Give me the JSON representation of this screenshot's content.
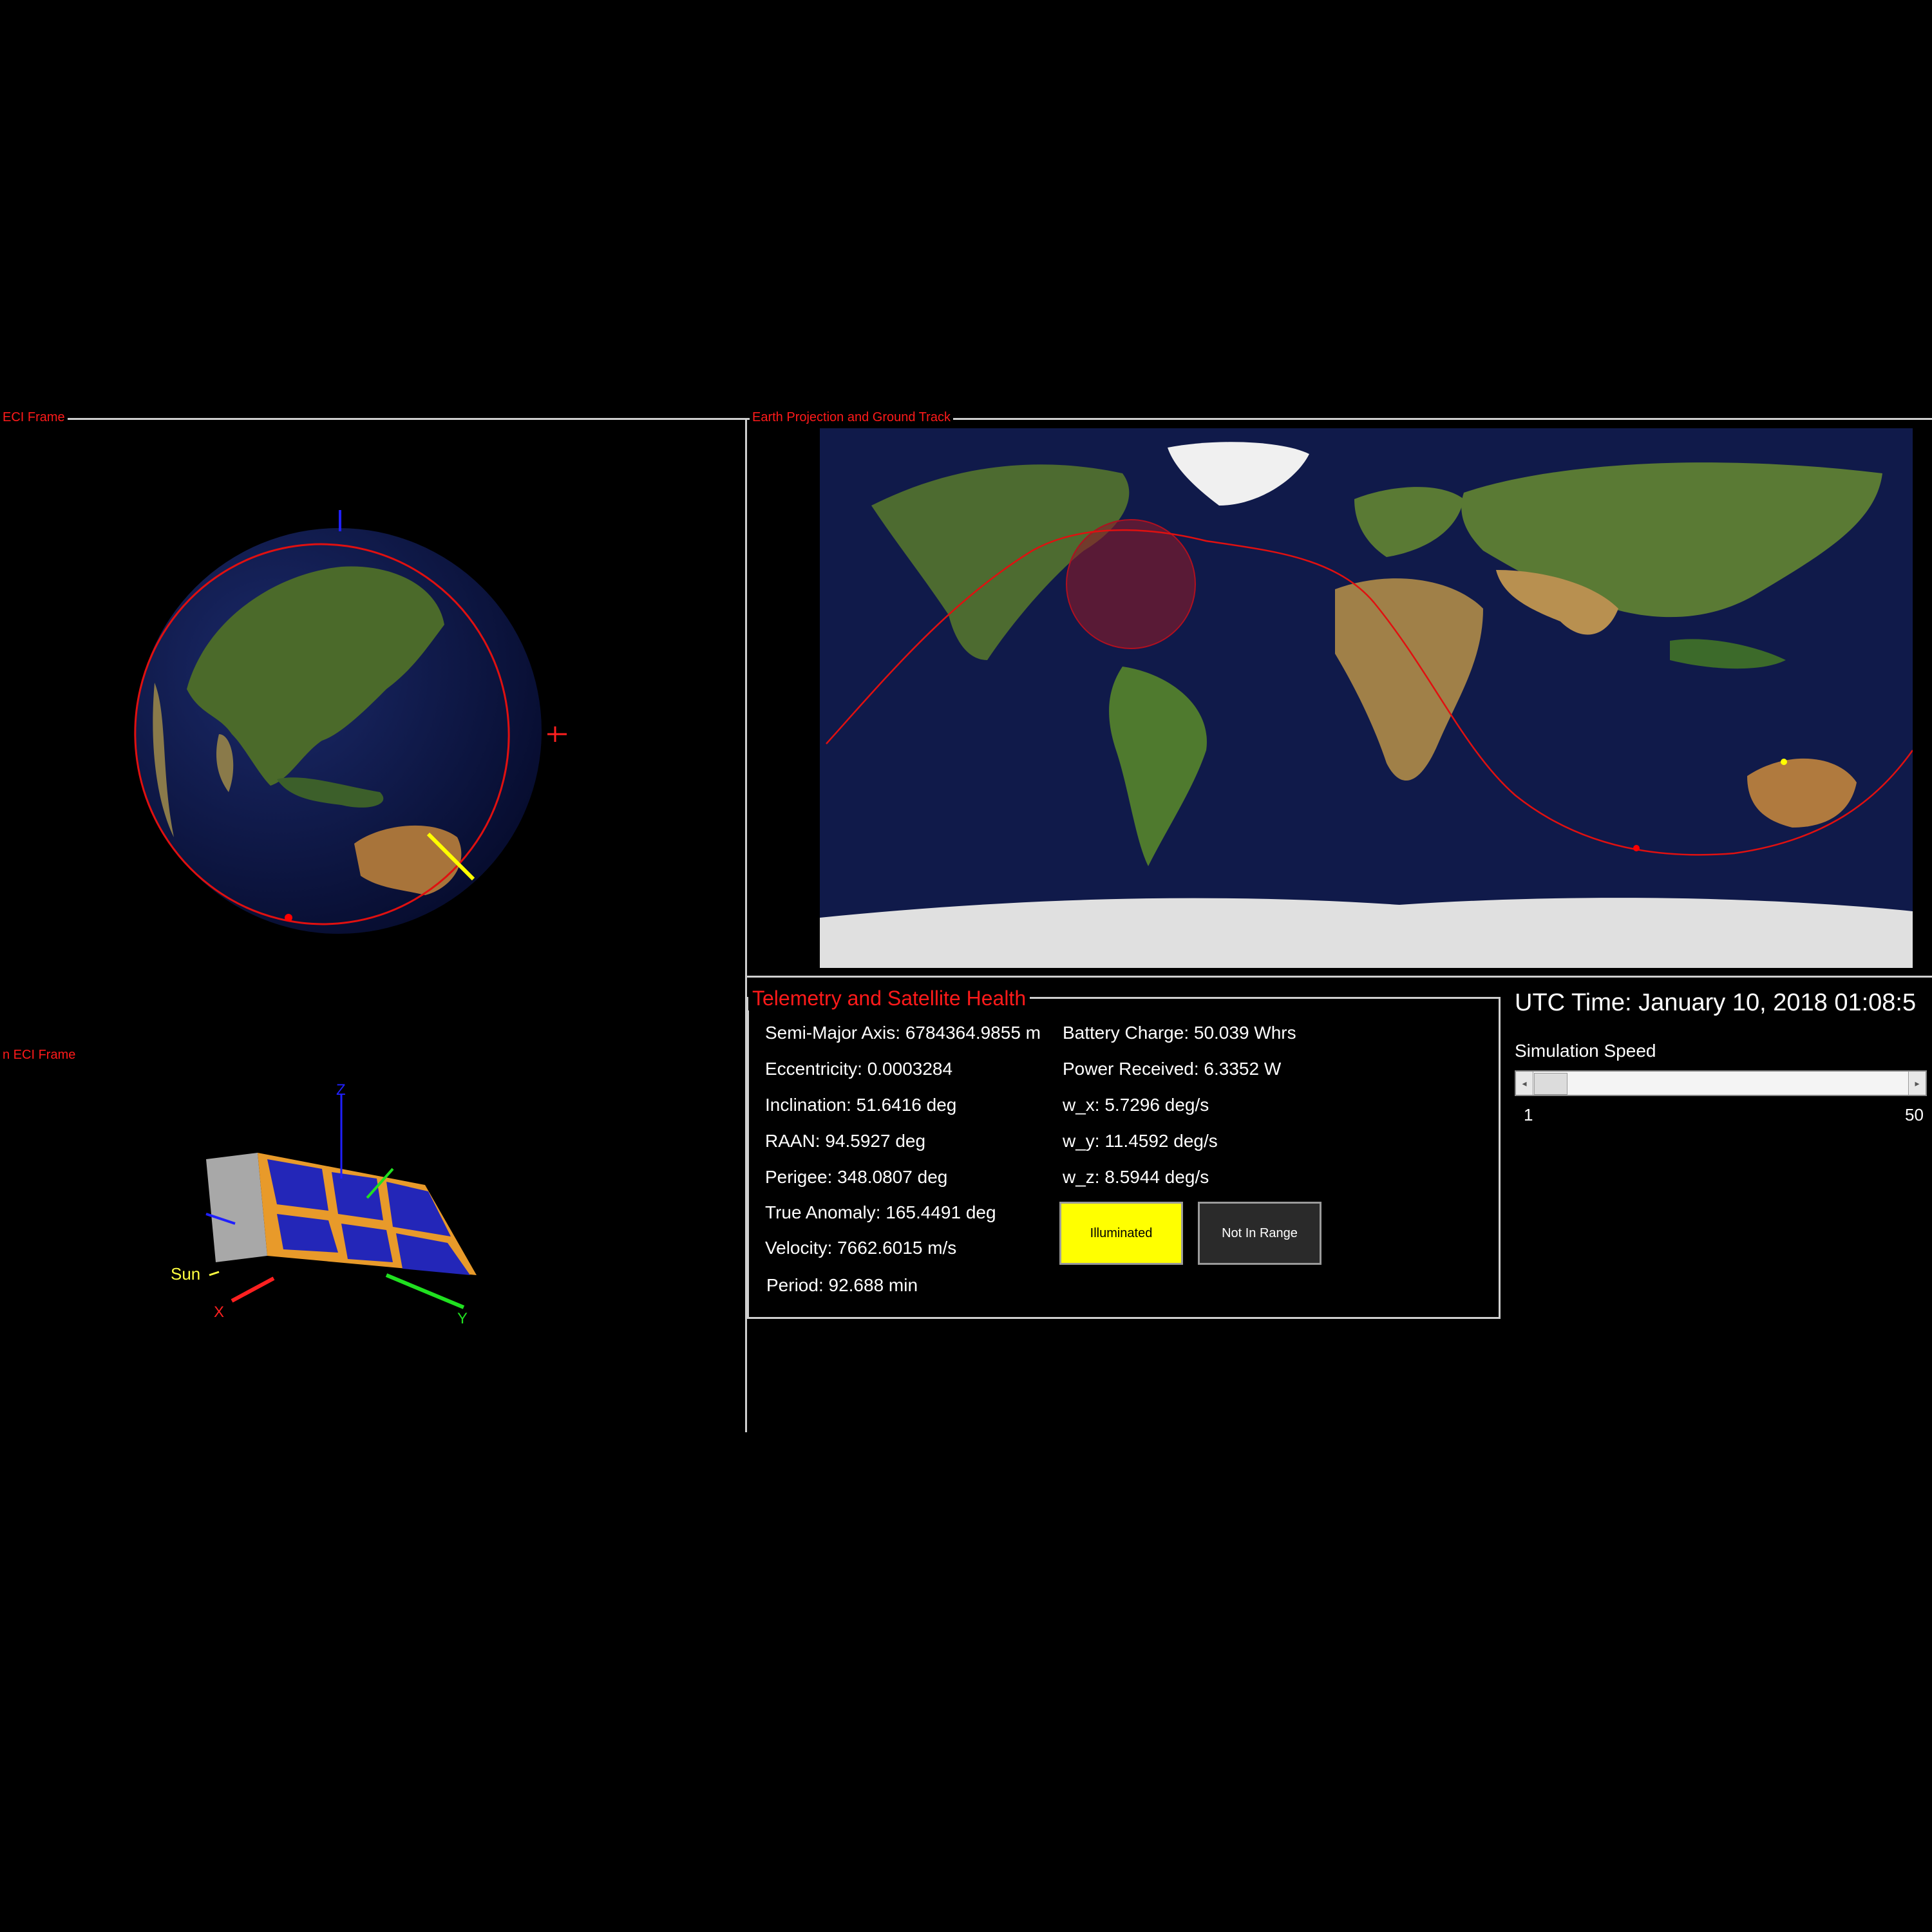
{
  "panels": {
    "eci_label": "ECI Frame",
    "attitude_label": "n ECI Frame",
    "map_label": "Earth Projection and Ground Track",
    "telemetry_label": "Telemetry and Satellite Health"
  },
  "telemetry": {
    "left": [
      "Semi-Major Axis: 6784364.9855 m",
      "Eccentricity: 0.0003284",
      "Inclination: 51.6416 deg",
      "RAAN: 94.5927 deg",
      "Perigee: 348.0807 deg",
      "True Anomaly: 165.4491 deg",
      "Velocity: 7662.6015 m/s",
      "Period: 92.688 min"
    ],
    "right": [
      "Battery Charge: 50.039 Whrs",
      "Power Received: 6.3352 W",
      "w_x: 5.7296 deg/s",
      "w_y: 11.4592 deg/s",
      "w_z: 8.5944 deg/s"
    ]
  },
  "status": {
    "illuminated_label": "Illuminated",
    "range_label": "Not In Range",
    "illuminated_color": "#ffff00",
    "range_color": "#2a2a2a"
  },
  "time": {
    "utc": "UTC Time: January 10, 2018 01:08:5"
  },
  "speed": {
    "label": "Simulation Speed",
    "min": "1",
    "max": "50",
    "value": 1
  },
  "axes": {
    "x": "X",
    "y": "Y",
    "z": "Z",
    "sun": "Sun"
  },
  "colors": {
    "label_red": "#ff1a1a",
    "orbit_red": "#e01010",
    "ocean": "#101a4a"
  }
}
